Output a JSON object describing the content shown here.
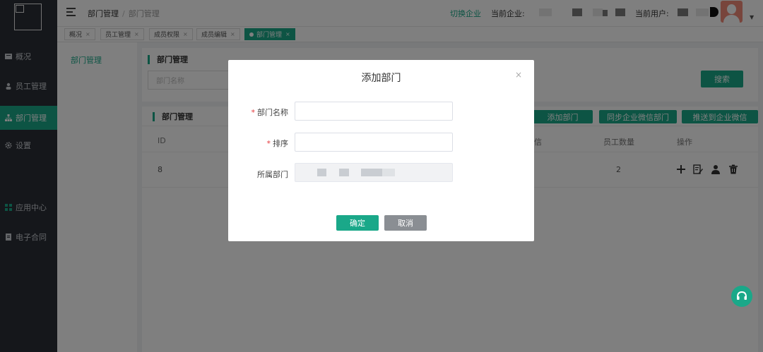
{
  "sidebar": {
    "items": [
      {
        "label": "概况",
        "icon": "dashboard-icon"
      },
      {
        "label": "员工管理",
        "icon": "users-icon"
      },
      {
        "label": "部门管理",
        "icon": "org-chart-icon"
      },
      {
        "label": "设置",
        "icon": "gear-icon"
      },
      {
        "label": "应用中心",
        "icon": "grid-icon"
      },
      {
        "label": "电子合同",
        "icon": "contract-icon"
      }
    ],
    "active_index": 2
  },
  "header": {
    "breadcrumb": [
      "部门管理",
      "部门管理"
    ],
    "switch_enterprise": "切换企业",
    "current_enterprise_label": "当前企业:",
    "current_user_label": "当前用户:"
  },
  "tabs": [
    {
      "label": "概况"
    },
    {
      "label": "员工管理"
    },
    {
      "label": "成员权限"
    },
    {
      "label": "成员编辑"
    },
    {
      "label": "部门管理",
      "active": true
    }
  ],
  "left_panel": {
    "item": "部门管理"
  },
  "search_panel": {
    "title": "部门管理",
    "input_placeholder": "部门名称",
    "search_button": "搜索"
  },
  "table_panel": {
    "title": "部门管理",
    "buttons": [
      "添加部门",
      "同步企业微信部门",
      "推送到企业微信"
    ],
    "columns": {
      "id": "ID",
      "wechat": "信",
      "employee_count": "员工数量",
      "actions": "操作"
    },
    "rows": [
      {
        "id": "8",
        "employee_count": "2"
      }
    ]
  },
  "modal": {
    "title": "添加部门",
    "close": "×",
    "fields": [
      {
        "label": "部门名称",
        "required": true,
        "value": ""
      },
      {
        "label": "排序",
        "required": true,
        "value": ""
      },
      {
        "label": "所属部门",
        "required": false,
        "disabled": true
      }
    ],
    "confirm": "确定",
    "cancel": "取消"
  },
  "colors": {
    "accent": "#1aa889",
    "sidebar": "#2b2f36",
    "cancel": "#8a8e93",
    "required": "#e4393c"
  }
}
